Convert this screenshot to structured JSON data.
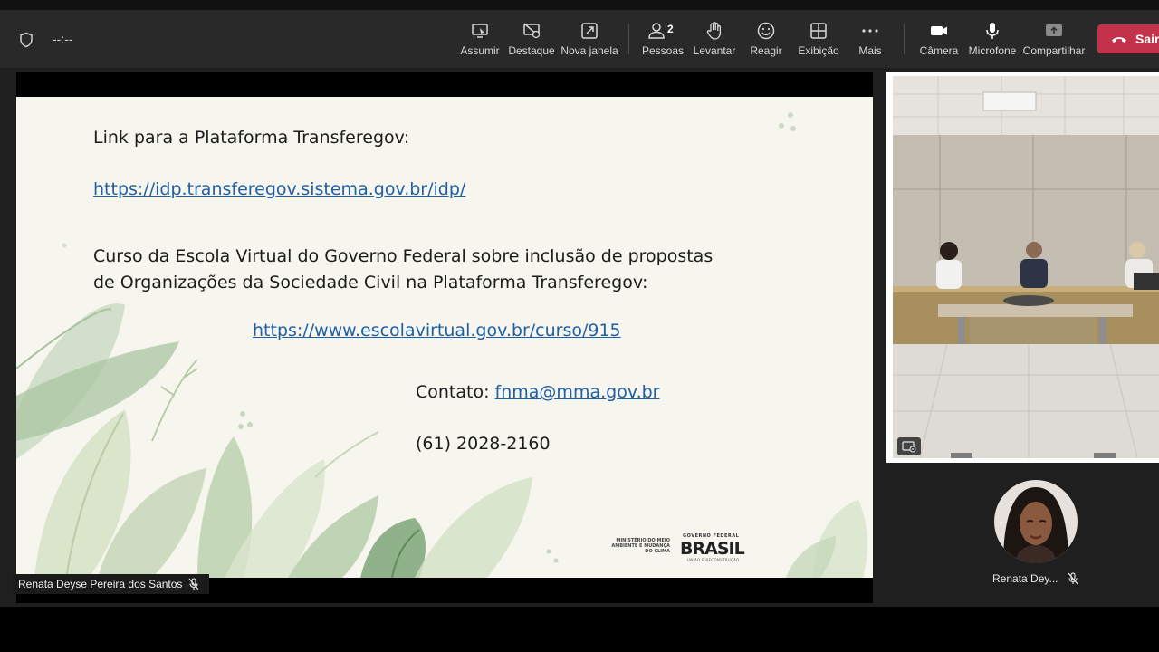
{
  "toolbar": {
    "timer": "--:--",
    "buttons": [
      {
        "label": "Assumir",
        "icon": "take-control-icon"
      },
      {
        "label": "Destaque",
        "icon": "spotlight-off-icon"
      },
      {
        "label": "Nova janela",
        "icon": "pop-out-icon"
      },
      {
        "label": "Pessoas",
        "icon": "people-icon",
        "count": "2"
      },
      {
        "label": "Levantar",
        "icon": "raise-hand-icon"
      },
      {
        "label": "Reagir",
        "icon": "react-icon"
      },
      {
        "label": "Exibição",
        "icon": "view-icon"
      },
      {
        "label": "Mais",
        "icon": "more-icon"
      },
      {
        "label": "Câmera",
        "icon": "camera-icon"
      },
      {
        "label": "Microfone",
        "icon": "microphone-icon"
      },
      {
        "label": "Compartilhar",
        "icon": "share-icon"
      }
    ],
    "leave_label": "Sair"
  },
  "slide": {
    "heading": "Link para a Plataforma Transferegov:",
    "link1": "https://idp.transferegov.sistema.gov.br/idp/",
    "course_line1": "Curso da Escola Virtual do Governo Federal sobre inclusão de propostas",
    "course_line2": "de Organizações da Sociedade Civil na Plataforma Transferegov:",
    "link2": "https://www.escolavirtual.gov.br/curso/915",
    "contact_label": "Contato: ",
    "contact_email": "fnma@mma.gov.br",
    "phone": "(61) 2028-2160",
    "ministry_logo": "MINISTÉRIO DO MEIO AMBIENTE E MUDANÇA DO CLIMA",
    "gov_logo_top": "GOVERNO FEDERAL",
    "gov_logo_main": "BRASIL",
    "gov_logo_bottom": "UNIÃO E RECONSTRUÇÃO"
  },
  "presenter": {
    "name": "Renata Deyse Pereira dos Santos"
  },
  "participant": {
    "name": "Renata Dey..."
  },
  "colors": {
    "toolbar": "#292929",
    "leave": "#c4314b",
    "link": "#1f5fa6",
    "slide_bg": "#f6f5ee"
  }
}
